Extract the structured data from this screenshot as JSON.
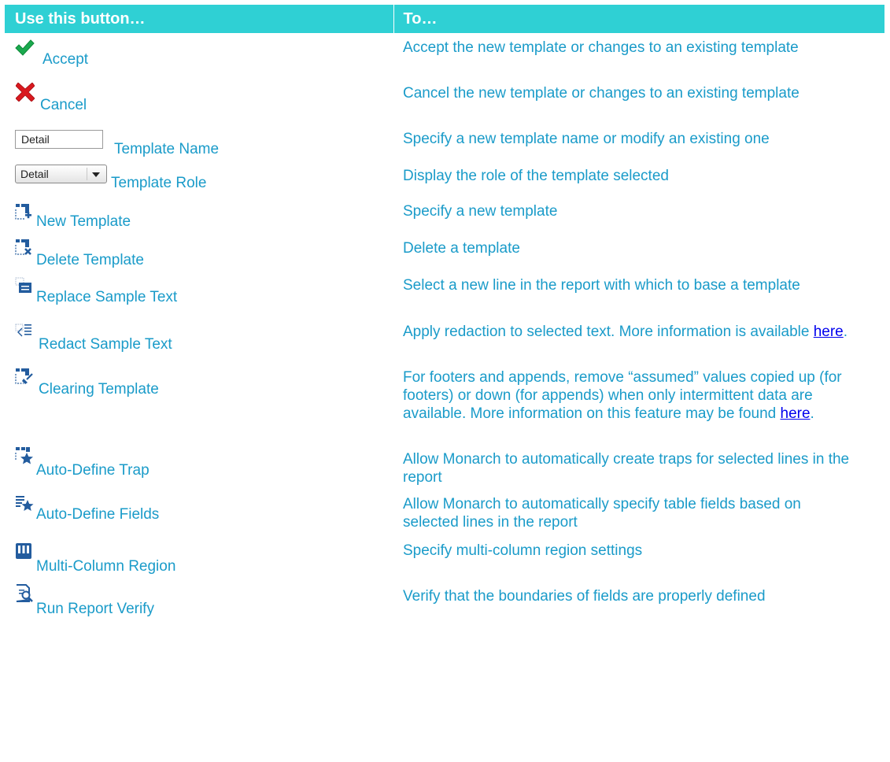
{
  "header": {
    "col1": "Use this button…",
    "col2": "To…"
  },
  "rows": [
    {
      "icon": "checkmark-icon",
      "label": "Accept",
      "desc": "Accept the new template or changes to an existing template"
    },
    {
      "icon": "x-cross-icon",
      "label": "Cancel",
      "desc": "Cancel the new template or changes to an existing template"
    },
    {
      "icon": "text-field",
      "field_value": "Detail",
      "label": "Template Name",
      "desc": "Specify a new template name or modify an existing one"
    },
    {
      "icon": "dropdown-select",
      "field_value": "Detail",
      "label": "Template Role",
      "desc": "Display the role of the template selected"
    },
    {
      "icon": "new-template-icon",
      "label": "New Template",
      "desc": "Specify a new template"
    },
    {
      "icon": "delete-template-icon",
      "label": "Delete Template",
      "desc": "Delete a template"
    },
    {
      "icon": "replace-sample-text-icon",
      "label": "Replace Sample Text",
      "desc": "Select a new line in the report with which to base a template"
    },
    {
      "icon": "redact-sample-text-icon",
      "label": "Redact Sample Text",
      "desc_before": "Apply redaction to selected text. More information is available ",
      "link": "here",
      "desc_after": "."
    },
    {
      "icon": "clearing-template-icon",
      "label": "Clearing Template",
      "desc_before": "For footers and appends, remove “assumed” values copied up (for footers) or down (for appends) when only intermittent data are available. More information on this feature may be found ",
      "link": "here",
      "desc_after": "."
    },
    {
      "icon": "auto-define-trap-icon",
      "label": "Auto-Define Trap",
      "desc": "Allow Monarch to automatically create traps for selected lines in the report"
    },
    {
      "icon": "auto-define-fields-icon",
      "label": "Auto-Define Fields",
      "desc": "Allow Monarch to automatically specify table fields based on selected lines in the report"
    },
    {
      "icon": "multi-column-region-icon",
      "label": "Multi-Column Region",
      "desc": "Specify multi-column region settings"
    },
    {
      "icon": "run-report-verify-icon",
      "label": "Run Report Verify",
      "desc": "Verify that the boundaries of fields are properly defined"
    }
  ],
  "colors": {
    "header_bg": "#2fd0d4",
    "text": "#1a9bc9",
    "link": "#0000ee"
  }
}
